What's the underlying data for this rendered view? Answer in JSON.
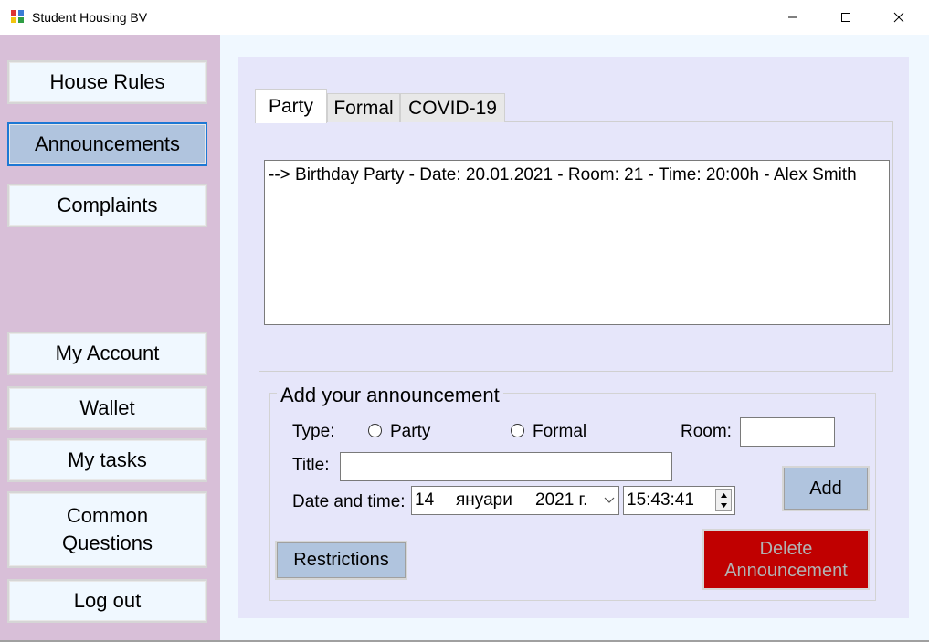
{
  "window": {
    "title": "Student Housing BV",
    "icons": [
      "app-icon",
      "minimize-icon",
      "maximize-icon",
      "close-icon"
    ]
  },
  "sidebar": {
    "items": [
      {
        "label": "House Rules"
      },
      {
        "label": "Announcements",
        "active": true
      },
      {
        "label": "Complaints"
      },
      {
        "label": "My Account"
      },
      {
        "label": "Wallet"
      },
      {
        "label": "My tasks"
      },
      {
        "label": "Common Questions"
      },
      {
        "label": "Log out"
      }
    ]
  },
  "tabs": [
    {
      "label": "Party",
      "selected": true
    },
    {
      "label": "Formal"
    },
    {
      "label": "COVID-19"
    }
  ],
  "announcements": [
    "--> Birthday Party - Date: 20.01.2021 - Room: 21 - Time: 20:00h - Alex Smith"
  ],
  "form": {
    "title": "Add your announcement",
    "type_label": "Type:",
    "type_options": [
      "Party",
      "Formal"
    ],
    "room_label": "Room:",
    "room_value": "",
    "title_label": "Title:",
    "title_value": "",
    "datetime_label": "Date and time:",
    "date_day": "14",
    "date_month": "януари",
    "date_year": "2021 г.",
    "time_value": "15:43:41",
    "add_label": "Add",
    "restrictions_label": "Restrictions",
    "delete_label": "Delete Announcement"
  },
  "colors": {
    "sidebar": "#d8bfd8",
    "panel": "#e6e6fa",
    "button": "#b0c4de",
    "nav_button": "#f0f8ff",
    "delete": "#c00000"
  }
}
